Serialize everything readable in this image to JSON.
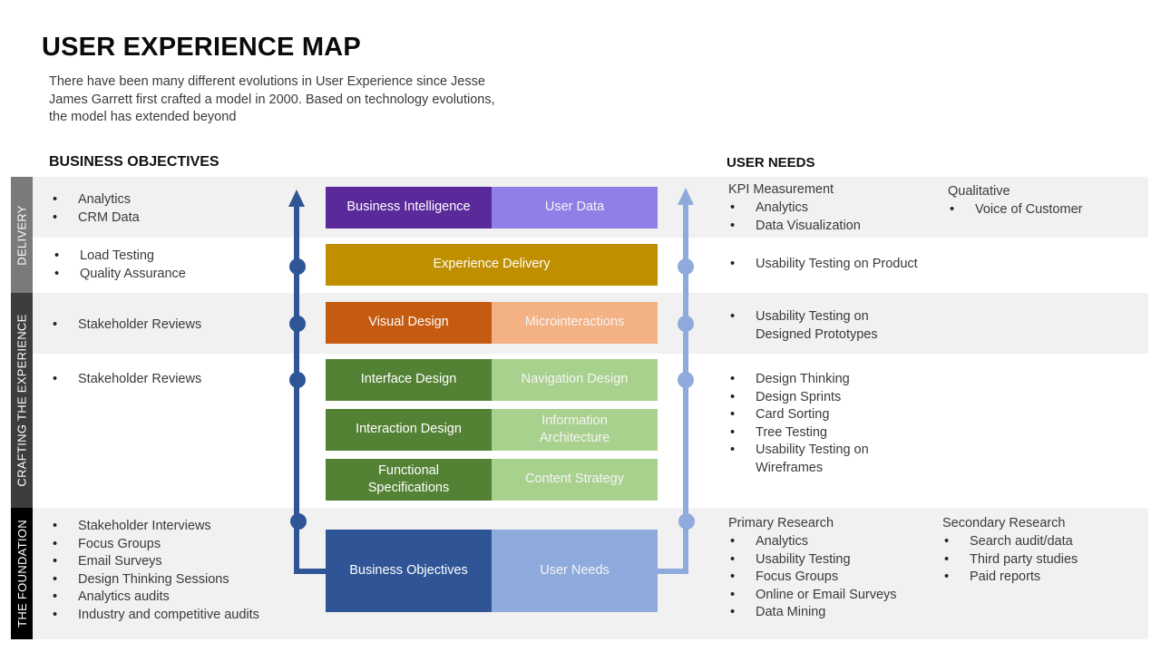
{
  "header": {
    "title": "USER EXPERIENCE MAP",
    "intro": "There have been many different evolutions in User Experience since Jesse James Garrett first crafted a model in 2000. Based on technology evolutions, the model has extended beyond"
  },
  "columns": {
    "left_heading": "BUSINESS OBJECTIVES",
    "right_heading": "USER NEEDS"
  },
  "phases": [
    {
      "label": "DELIVERY"
    },
    {
      "label": "CRAFTING THE EXPERIENCE"
    },
    {
      "label": "THE FOUNDATION"
    }
  ],
  "business_objectives": {
    "delivery_top": [
      "Analytics",
      "CRM Data"
    ],
    "delivery_bottom": [
      "Load Testing",
      "Quality Assurance"
    ],
    "crafting_top": [
      "Stakeholder Reviews"
    ],
    "crafting_bottom": [
      "Stakeholder Reviews"
    ],
    "foundation": [
      "Stakeholder Interviews",
      "Focus Groups",
      "Email Surveys",
      "Design Thinking Sessions",
      "Analytics audits",
      "Industry and competitive audits"
    ]
  },
  "center_boxes": {
    "business_intelligence": "Business Intelligence",
    "user_data": "User Data",
    "experience_delivery": "Experience Delivery",
    "visual_design": "Visual Design",
    "microinteractions": "Microinteractions",
    "interface_design": "Interface Design",
    "navigation_design": "Navigation Design",
    "interaction_design": "Interaction Design",
    "information_architecture": "Information Architecture",
    "functional_specifications": "Functional Specifications",
    "content_strategy": "Content Strategy",
    "business_objectives": "Business Objectives",
    "user_needs": "User Needs"
  },
  "colors": {
    "purple_dark": "#5b2a9a",
    "purple_light": "#8f7fe6",
    "gold": "#bf8f00",
    "orange_dark": "#c55a11",
    "orange_light": "#f4b183",
    "green_dark": "#548235",
    "green_light": "#a9d18e",
    "blue_dark": "#2f5597",
    "blue_light": "#8faadc",
    "band_gray": "#f1f1f1",
    "side_delivery": "#7a7a7a",
    "side_crafting": "#3d3d3d",
    "side_foundation": "#000000"
  },
  "user_needs": {
    "kpi": {
      "title": "KPI Measurement",
      "items": [
        "Analytics",
        "Data Visualization"
      ]
    },
    "qualitative": {
      "title": "Qualitative",
      "items": [
        "Voice of Customer"
      ]
    },
    "delivery_bottom": [
      "Usability Testing on Product"
    ],
    "crafting_top": [
      "Usability Testing on Designed Prototypes"
    ],
    "crafting_bottom": [
      "Design Thinking",
      "Design Sprints",
      "Card Sorting",
      "Tree Testing",
      "Usability Testing on Wireframes"
    ],
    "primary": {
      "title": "Primary Research",
      "items": [
        "Analytics",
        "Usability Testing",
        "Focus Groups",
        "Online or Email Surveys",
        "Data Mining"
      ]
    },
    "secondary": {
      "title": "Secondary Research",
      "items": [
        "Search audit/data",
        "Third party studies",
        "Paid reports"
      ]
    }
  }
}
